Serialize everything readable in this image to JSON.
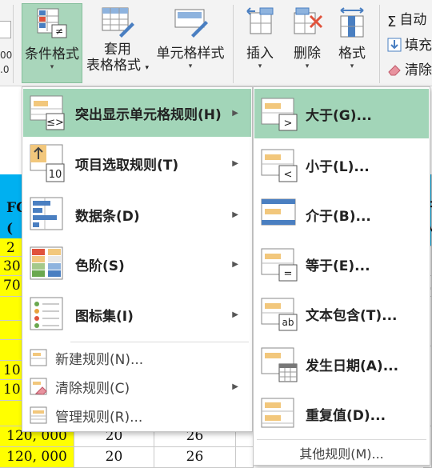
{
  "ribbon": {
    "left_numbers": [
      "00",
      ".0"
    ],
    "launcher": "↳",
    "conditional_format": "条件格式",
    "table_format_line1": "套用",
    "table_format_line2": "表格格式",
    "cell_style": "单元格样式",
    "insert": "插入",
    "delete": "删除",
    "format": "格式",
    "autosum": "自动",
    "fill": "填充",
    "clear": "清除"
  },
  "sheet": {
    "left_partial": [
      "FC",
      "(",
      "2",
      "30",
      "70",
      "10",
      "10"
    ],
    "rows": [
      {
        "a": "120, 000",
        "b": "20",
        "c": "26"
      },
      {
        "a": "120, 000",
        "b": "20",
        "c": "26"
      }
    ],
    "right_partial": [
      "于",
      "人",
      "2"
    ]
  },
  "main_menu": {
    "items": [
      {
        "label": "突出显示单元格规则(H)",
        "icon": "highlight-rules-icon"
      },
      {
        "label": "项目选取规则(T)",
        "icon": "top-bottom-icon"
      },
      {
        "label": "数据条(D)",
        "icon": "data-bars-icon"
      },
      {
        "label": "色阶(S)",
        "icon": "color-scales-icon"
      },
      {
        "label": "图标集(I)",
        "icon": "icon-sets-icon"
      },
      {
        "label": "新建规则(N)...",
        "icon": "new-rule-icon"
      },
      {
        "label": "清除规则(C)",
        "icon": "clear-rules-icon"
      },
      {
        "label": "管理规则(R)...",
        "icon": "manage-rules-icon"
      }
    ],
    "icon_badge_10": "10"
  },
  "sub_menu": {
    "items": [
      {
        "label": "大于(G)...",
        "glyph": ">"
      },
      {
        "label": "小于(L)...",
        "glyph": "<"
      },
      {
        "label": "介于(B)...",
        "glyph": ""
      },
      {
        "label": "等于(E)...",
        "glyph": "="
      },
      {
        "label": "文本包含(T)...",
        "glyph": "ab"
      },
      {
        "label": "发生日期(A)...",
        "glyph": ""
      },
      {
        "label": "重复值(D)...",
        "glyph": ""
      }
    ],
    "more_rules": "其他规则(M)..."
  },
  "colors": {
    "highlight": "#a2d5b8",
    "yellow": "#ffff00",
    "cyan": "#00b0f0",
    "icon_orange": "#f2c77c",
    "icon_blue": "#4a7fc1"
  }
}
